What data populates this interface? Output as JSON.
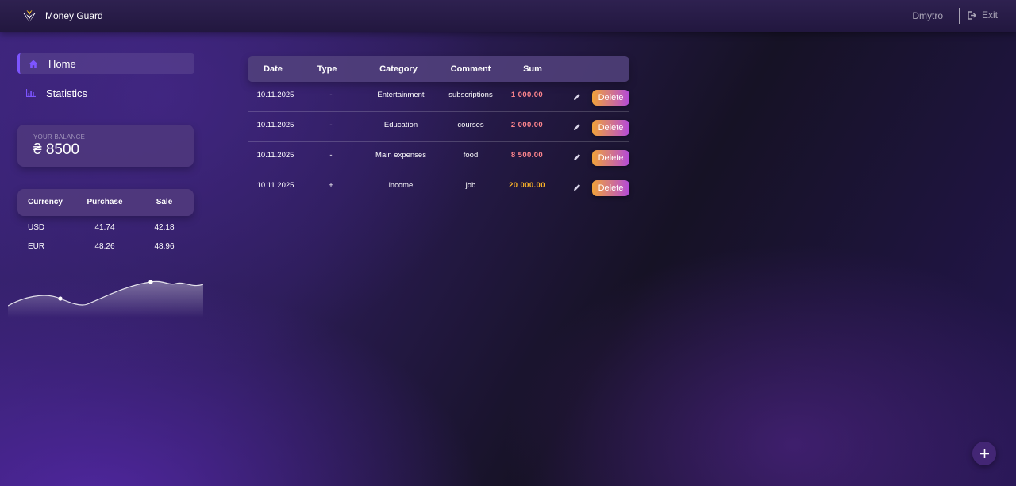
{
  "header": {
    "app_name": "Money Guard",
    "user_name": "Dmytro",
    "exit_label": "Exit"
  },
  "sidebar": {
    "items": [
      {
        "label": "Home",
        "icon": "home-icon",
        "active": true
      },
      {
        "label": "Statistics",
        "icon": "statistics-icon",
        "active": false
      }
    ]
  },
  "balance": {
    "label": "Your balance",
    "value": "₴ 8500"
  },
  "currency": {
    "headers": [
      "Currency",
      "Purchase",
      "Sale"
    ],
    "rows": [
      {
        "currency": "USD",
        "purchase": "41.74",
        "sale": "42.18"
      },
      {
        "currency": "EUR",
        "purchase": "48.26",
        "sale": "48.96"
      }
    ]
  },
  "table": {
    "headers": [
      "Date",
      "Type",
      "Category",
      "Comment",
      "Sum"
    ],
    "delete_label": "Delete",
    "rows": [
      {
        "date": "10.11.2025",
        "type": "-",
        "category": "Entertainment",
        "comment": "subscriptions",
        "sum": "1 000.00",
        "kind": "expense"
      },
      {
        "date": "10.11.2025",
        "type": "-",
        "category": "Education",
        "comment": "courses",
        "sum": "2 000.00",
        "kind": "expense"
      },
      {
        "date": "10.11.2025",
        "type": "-",
        "category": "Main expenses",
        "comment": "food",
        "sum": "8 500.00",
        "kind": "expense"
      },
      {
        "date": "10.11.2025",
        "type": "+",
        "category": "income",
        "comment": "job",
        "sum": "20 000.00",
        "kind": "income"
      }
    ]
  },
  "colors": {
    "expense": "#ff868d",
    "income": "#ffb627",
    "accent": "#7d55ff",
    "delete_gradient_start": "#f0a23a",
    "delete_gradient_end": "#b44ad8"
  },
  "icons": {
    "logo": "money-guard-logo",
    "exit": "exit-icon",
    "edit": "pencil-icon",
    "add": "plus-icon"
  }
}
